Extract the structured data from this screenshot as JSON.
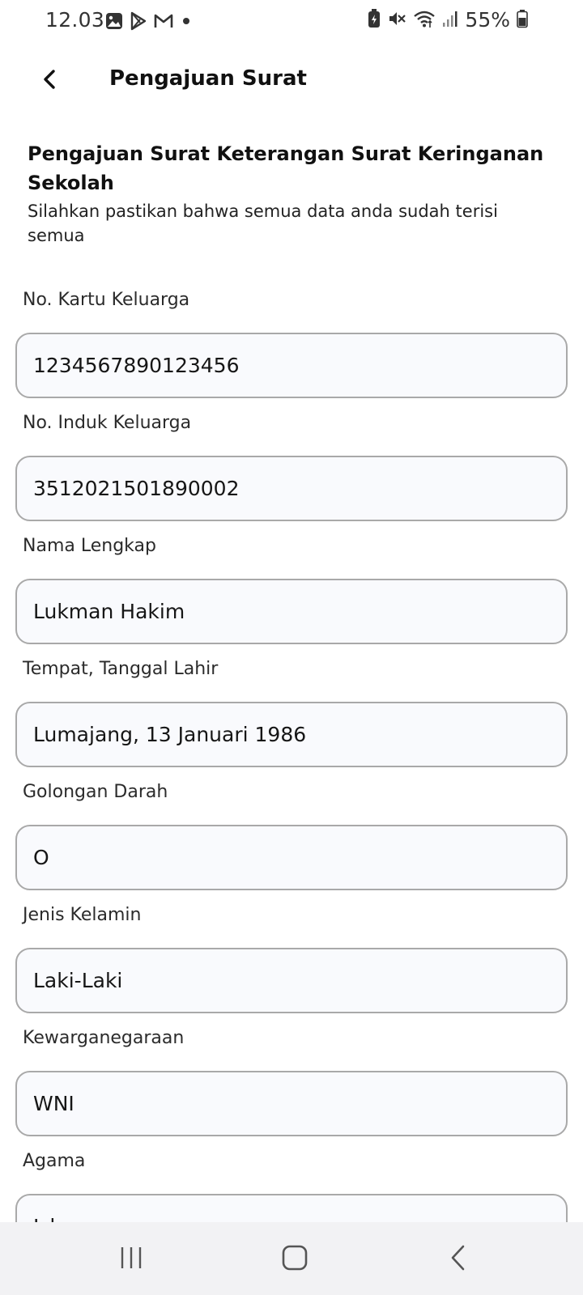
{
  "status_bar": {
    "time": "12.03",
    "battery_percent": "55%",
    "left_icons": [
      "gallery-icon",
      "play-store-icon",
      "gmail-icon",
      "dot-icon"
    ],
    "right_icons": [
      "battery-saver-icon",
      "mute-icon",
      "wifi-icon",
      "signal-icon",
      "battery-icon"
    ]
  },
  "app_bar": {
    "title": "Pengajuan Surat"
  },
  "form": {
    "heading": "Pengajuan Surat Keterangan Surat Keringanan Sekolah",
    "subtitle": "Silahkan pastikan bahwa semua data anda sudah terisi semua",
    "fields": [
      {
        "label": "No. Kartu Keluarga",
        "value": "1234567890123456"
      },
      {
        "label": "No. Induk Keluarga",
        "value": "3512021501890002"
      },
      {
        "label": "Nama Lengkap",
        "value": "Lukman Hakim"
      },
      {
        "label": "Tempat, Tanggal Lahir",
        "value": "Lumajang, 13 Januari 1986"
      },
      {
        "label": "Golongan Darah",
        "value": "O"
      },
      {
        "label": "Jenis Kelamin",
        "value": "Laki-Laki"
      },
      {
        "label": "Kewarganegaraan",
        "value": "WNI"
      },
      {
        "label": "Agama",
        "value": "Islam"
      }
    ]
  },
  "nav_bar": {
    "icons": [
      "recent-apps-icon",
      "home-icon",
      "back-nav-icon"
    ]
  }
}
